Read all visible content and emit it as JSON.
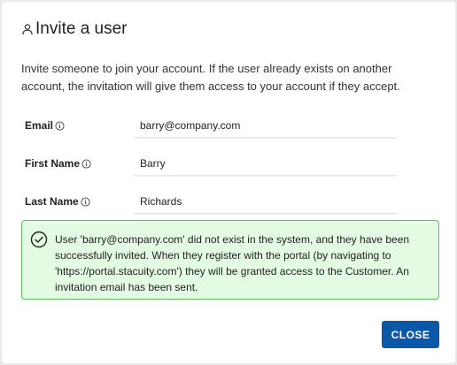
{
  "dialog": {
    "title": "Invite a user",
    "title_icon": "user-icon",
    "description": "Invite someone to join your account. If the user already exists on another account, the invitation will give them access to your account if they accept."
  },
  "form": {
    "email": {
      "label": "Email",
      "value": "barry@company.com",
      "icon": "info-icon"
    },
    "first_name": {
      "label": "First Name",
      "value": "Barry",
      "icon": "info-icon"
    },
    "last_name": {
      "label": "Last Name",
      "value": "Richards",
      "icon": "info-icon"
    }
  },
  "alert": {
    "icon": "check-circle-icon",
    "message": "User 'barry@company.com' did not exist in the system, and they have been successfully invited. When they register with the portal (by navigating to 'https://portal.stacuity.com') they will be granted access to the Customer. An invitation email has been sent.",
    "background_color": "#e3fbe3",
    "border_color": "#56c456"
  },
  "footer": {
    "close_label": "CLOSE",
    "button_color": "#0b57a8"
  }
}
